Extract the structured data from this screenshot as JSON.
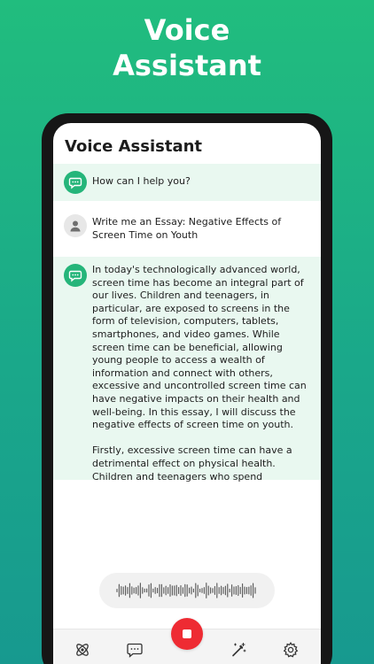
{
  "hero": {
    "line1": "Voice",
    "line2": "Assistant"
  },
  "app": {
    "title": "Voice Assistant"
  },
  "messages": [
    {
      "role": "bot",
      "text": "How can I help you?"
    },
    {
      "role": "user",
      "line1": "Write me an Essay: Negative Effects of",
      "line2": "Screen Time on Youth"
    },
    {
      "role": "bot",
      "paragraph1_lines": [
        "In today's technologically advanced world,",
        "screen time has become an integral part of",
        "our lives. Children and teenagers, in",
        "particular, are exposed to screens in the",
        "form of television, computers, tablets,",
        "smartphones, and video games. While",
        "screen time can be beneficial, allowing",
        "young people to access a wealth of",
        "information and connect with others,",
        "excessive and uncontrolled screen time can",
        "have negative impacts on their health and",
        "well-being. In this essay, I will discuss the",
        "negative effects of screen time on youth."
      ],
      "paragraph2_lines": [
        "Firstly, excessive screen time can have a",
        "detrimental effect on physical health.",
        "Children and teenagers who spend"
      ]
    }
  ],
  "icons": {
    "bot_avatar": "chat-bubble-icon",
    "user_avatar": "person-icon",
    "nav": [
      "atom-icon",
      "chat-icon",
      "magic-wand-icon",
      "gear-icon"
    ],
    "record": "stop-icon"
  },
  "colors": {
    "brand_green": "#21bd7e",
    "bot_bubble_bg": "#e9f8f0",
    "record_red": "#ee2b33"
  }
}
